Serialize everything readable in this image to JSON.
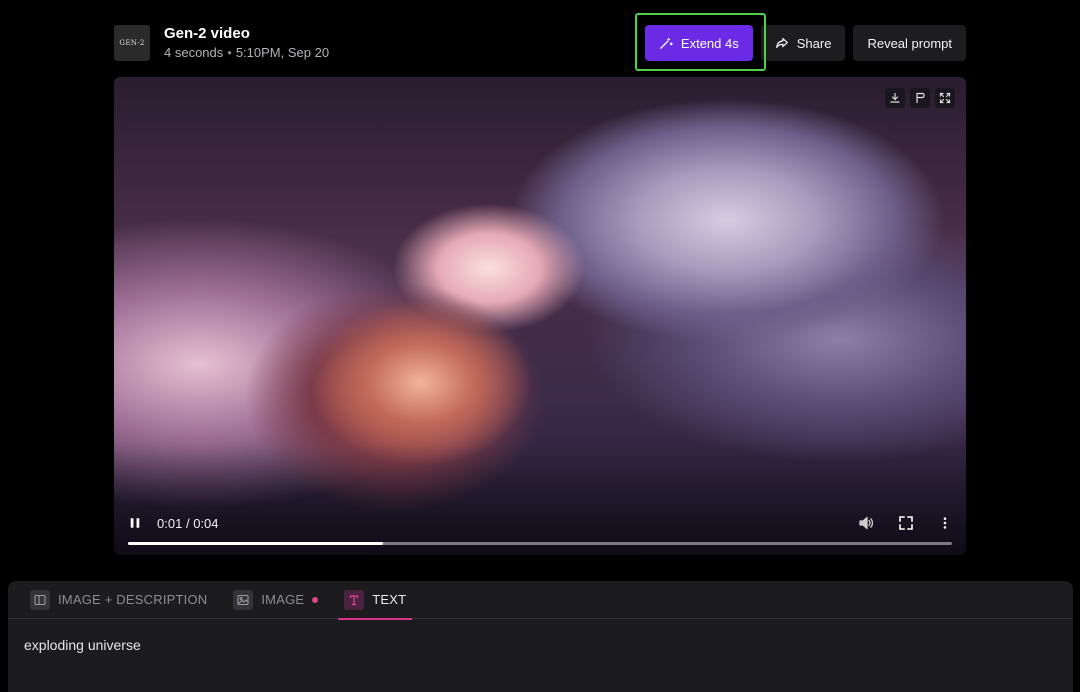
{
  "header": {
    "thumb_label": "GEN-2",
    "title": "Gen-2 video",
    "duration": "4 seconds",
    "separator": "•",
    "timestamp": "5:10PM, Sep 20"
  },
  "actions": {
    "extend_label": "Extend 4s",
    "share_label": "Share",
    "reveal_label": "Reveal prompt"
  },
  "player": {
    "current_time": "0:01",
    "time_separator": "/",
    "total_time": "0:04",
    "progress_fraction": 0.31,
    "tools": [
      "download-icon",
      "flag-icon",
      "expand-icon"
    ]
  },
  "tabs": [
    {
      "label": "IMAGE + DESCRIPTION",
      "icon": "image-description-icon",
      "active": false
    },
    {
      "label": "IMAGE",
      "icon": "image-icon",
      "active": false,
      "has_dot": true
    },
    {
      "label": "TEXT",
      "icon": "text-icon",
      "active": true
    }
  ],
  "prompt_text": "exploding universe",
  "colors": {
    "accent": "#6b2ae6",
    "highlight": "#4ed04e",
    "tab_active": "#d5348c"
  }
}
